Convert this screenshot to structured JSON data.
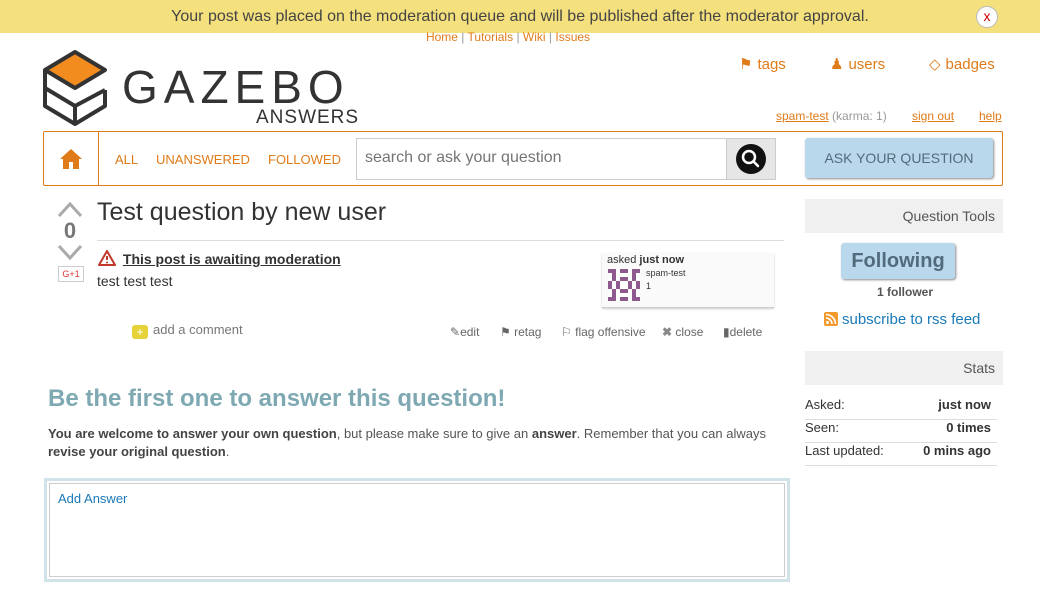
{
  "notification": {
    "message": "Your post was placed on the moderation queue and will be published after the moderator approval.",
    "close": "x"
  },
  "toplinks": [
    "Home",
    "Tutorials",
    "Wiki",
    "Issues"
  ],
  "logo": {
    "word": "GAZEBO",
    "sub": "ANSWERS"
  },
  "metanav": {
    "tags": "tags",
    "users": "users",
    "badges": "badges"
  },
  "user": {
    "name": "spam-test",
    "karma": "(karma: 1)",
    "signout": "sign out",
    "help": "help"
  },
  "scopes": {
    "all": "ALL",
    "unanswered": "UNANSWERED",
    "followed": "FOLLOWED"
  },
  "search": {
    "placeholder": "search or ask your question"
  },
  "ask_button": "ASK YOUR QUESTION",
  "question": {
    "title": "Test question by new user",
    "votes": "0",
    "gplus": "G+1",
    "moderation": "This post is awaiting moderation",
    "body": "test test test",
    "asked_label": "asked",
    "asked_when": "just now",
    "author": "spam-test",
    "author_karma": "1",
    "add_comment": "add a comment",
    "actions": {
      "edit": "edit",
      "retag": "retag",
      "flag": "flag offensive",
      "close": "close",
      "delete": "delete"
    }
  },
  "answer": {
    "heading": "Be the first one to answer this question!",
    "p1_b1": "You are welcome to answer your own question",
    "p1_t1": ", but please make sure to give an ",
    "p1_b2": "answer",
    "p1_t2": ". Remember that you can always ",
    "p1_b3": "revise your original question",
    "p1_t3": ".",
    "editor_label": "Add Answer"
  },
  "sidebar": {
    "tools_title": "Question Tools",
    "following": "Following",
    "followers": "1 follower",
    "rss": "subscribe to rss feed",
    "stats_title": "Stats",
    "stats": [
      {
        "label": "Asked:",
        "value": "just now"
      },
      {
        "label": "Seen:",
        "value": "0 times"
      },
      {
        "label": "Last updated:",
        "value": "0 mins ago"
      }
    ]
  },
  "colors": {
    "accent": "#e07b1a",
    "banner": "#f5e07e",
    "button": "#b9d8ec",
    "heading": "#7ea9b3"
  }
}
